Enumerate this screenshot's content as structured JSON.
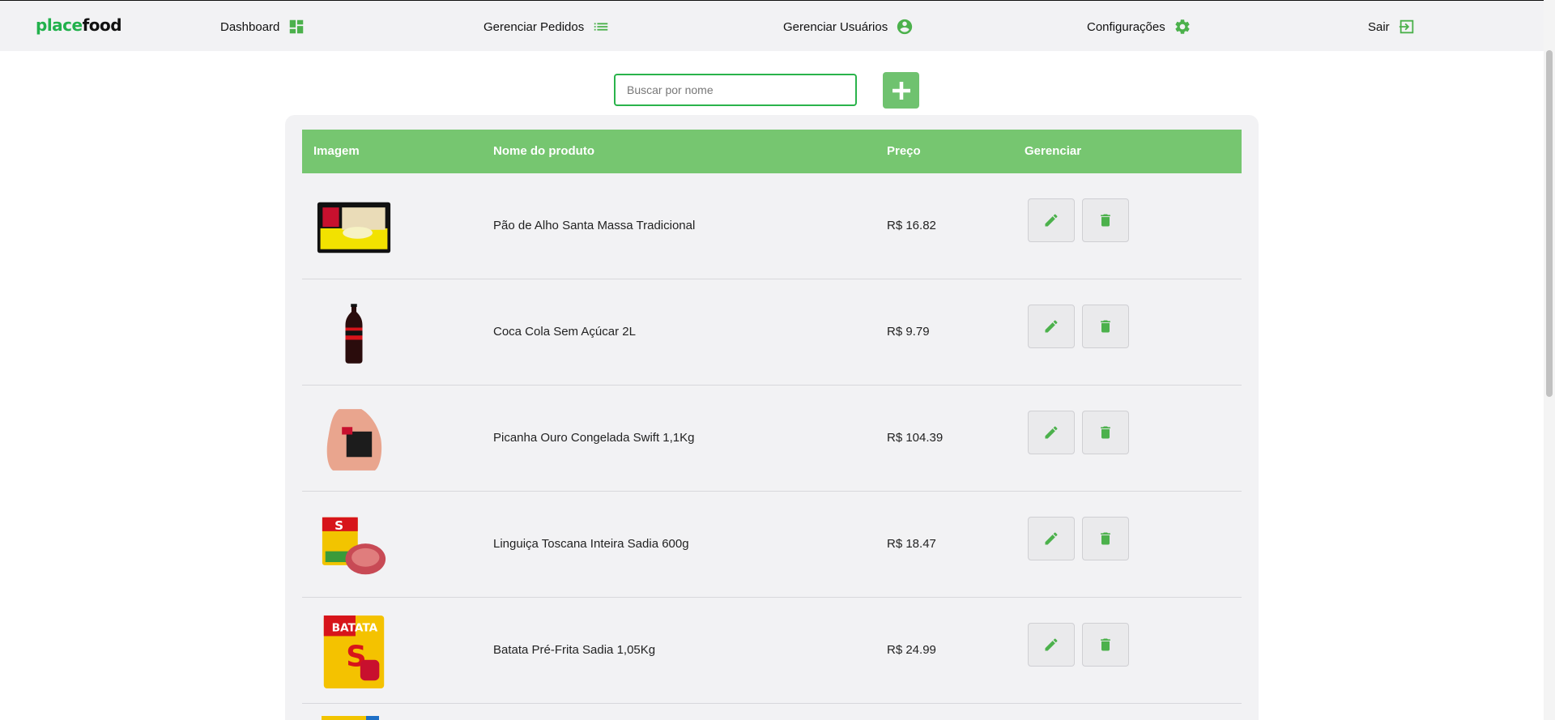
{
  "brand": {
    "part1": "place",
    "part2": "food"
  },
  "nav": {
    "dashboard": "Dashboard",
    "orders": "Gerenciar Pedidos",
    "users": "Gerenciar Usuários",
    "settings": "Configurações",
    "logout": "Sair"
  },
  "search": {
    "placeholder": "Buscar por nome",
    "value": ""
  },
  "table": {
    "headers": {
      "image": "Imagem",
      "name": "Nome do produto",
      "price": "Preço",
      "manage": "Gerenciar"
    },
    "rows": [
      {
        "name": "Pão de Alho Santa Massa Tradicional",
        "price": "R$ 16.82"
      },
      {
        "name": "Coca Cola Sem Açúcar 2L",
        "price": "R$ 9.79"
      },
      {
        "name": "Picanha Ouro Congelada Swift 1,1Kg",
        "price": "R$ 104.39"
      },
      {
        "name": "Linguiça Toscana Inteira Sadia 600g",
        "price": "R$ 18.47"
      },
      {
        "name": "Batata Pré-Frita Sadia 1,05Kg",
        "price": "R$ 24.99"
      }
    ]
  },
  "colors": {
    "accent": "#76c670",
    "brand_green": "#22b14c",
    "icon_green": "#4cb14c"
  }
}
